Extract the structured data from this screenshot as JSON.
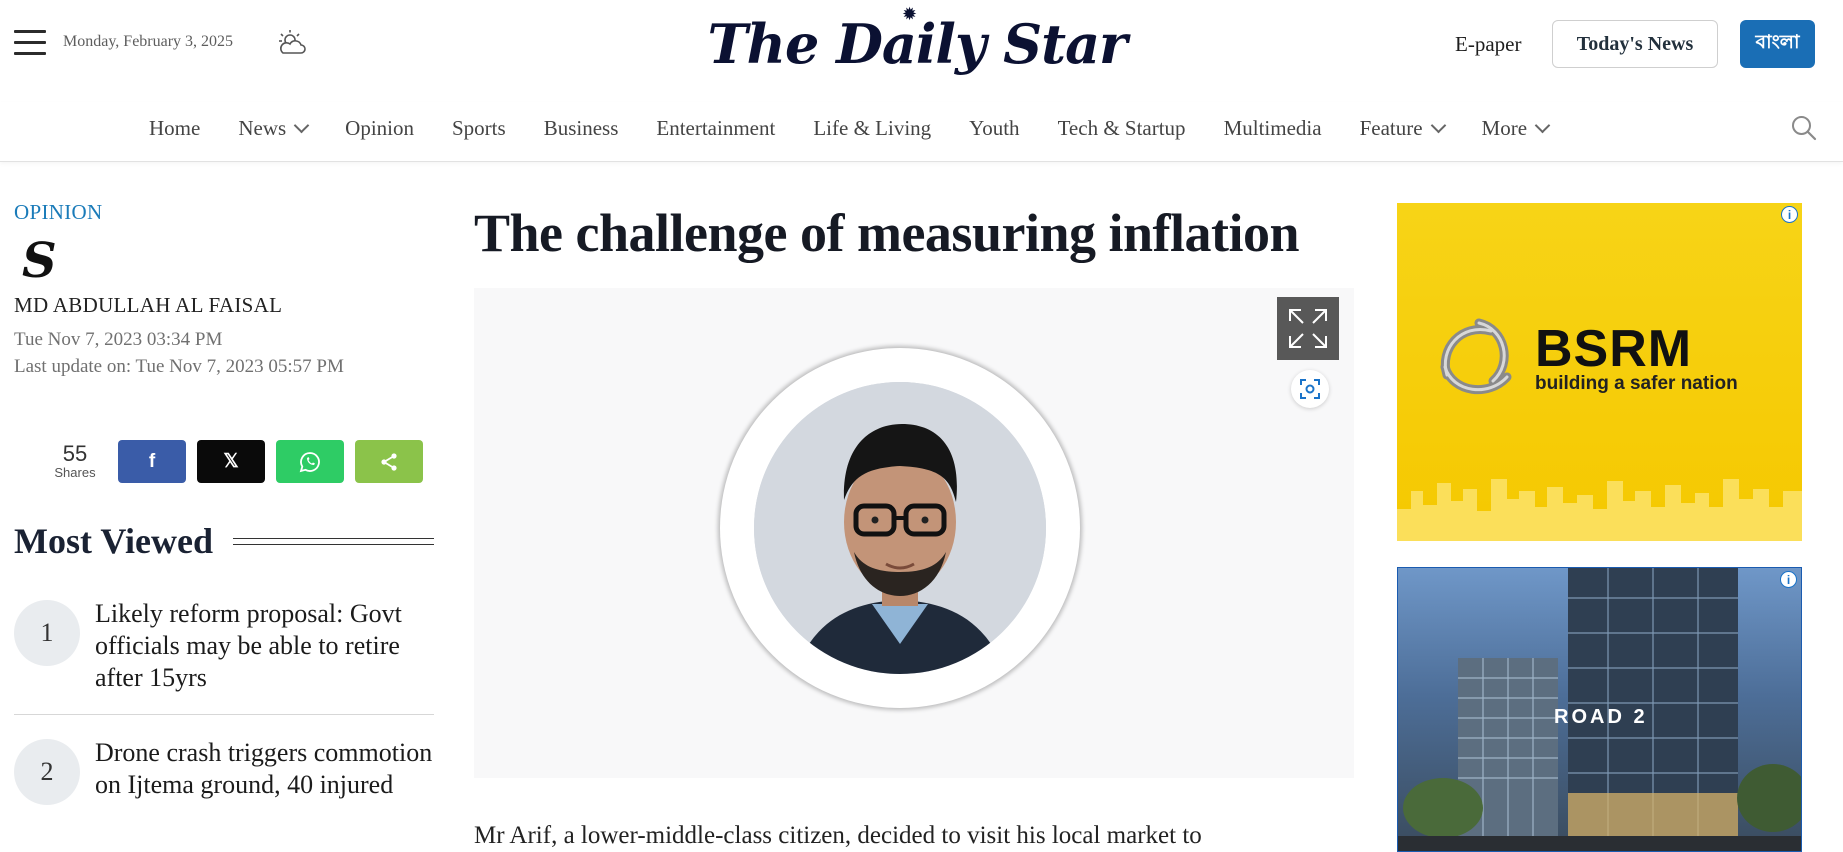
{
  "header": {
    "date": "Monday, February 3, 2025",
    "logo_text": "The Daily Star",
    "epaper": "E-paper",
    "todays_news": "Today's News",
    "bangla": "বাংলা"
  },
  "nav": {
    "items": [
      {
        "label": "Home",
        "dropdown": false
      },
      {
        "label": "News",
        "dropdown": true
      },
      {
        "label": "Opinion",
        "dropdown": false
      },
      {
        "label": "Sports",
        "dropdown": false
      },
      {
        "label": "Business",
        "dropdown": false
      },
      {
        "label": "Entertainment",
        "dropdown": false
      },
      {
        "label": "Life & Living",
        "dropdown": false
      },
      {
        "label": "Youth",
        "dropdown": false
      },
      {
        "label": "Tech & Startup",
        "dropdown": false
      },
      {
        "label": "Multimedia",
        "dropdown": false
      },
      {
        "label": "Feature",
        "dropdown": true
      },
      {
        "label": "More",
        "dropdown": true
      }
    ]
  },
  "article": {
    "category": "OPINION",
    "author_logo": "S",
    "author": "MD ABDULLAH AL FAISAL",
    "published": "Tue Nov 7, 2023 03:34 PM",
    "updated": "Last update on: Tue Nov 7, 2023 05:57 PM",
    "headline": "The challenge of measuring inflation",
    "body_first_line": "Mr Arif, a lower-middle-class citizen, decided to visit his local market to"
  },
  "share": {
    "count": "55",
    "count_label": "Shares",
    "buttons": {
      "facebook": "f",
      "x": "𝕏",
      "whatsapp": "whatsapp-icon",
      "share": "share-icon"
    }
  },
  "most_viewed": {
    "title": "Most Viewed",
    "items": [
      {
        "rank": "1",
        "title": "Likely reform proposal: Govt officials may be able to retire after 15yrs"
      },
      {
        "rank": "2",
        "title": "Drone crash triggers commotion on Ijtema ground, 40 injured"
      }
    ]
  },
  "ads": {
    "ad1": {
      "brand": "BSRM",
      "tagline": "building a safer nation",
      "info": "i"
    },
    "ad2": {
      "caption": "ROAD 2",
      "info": "i"
    }
  },
  "colors": {
    "accent_blue": "#1a6eb5",
    "category_blue": "#1a7bb9",
    "facebook": "#3a5ca8",
    "x": "#0a0a0a",
    "whatsapp": "#2ecc65",
    "share": "#8bc34a",
    "ad_yellow": "#f5c800"
  }
}
